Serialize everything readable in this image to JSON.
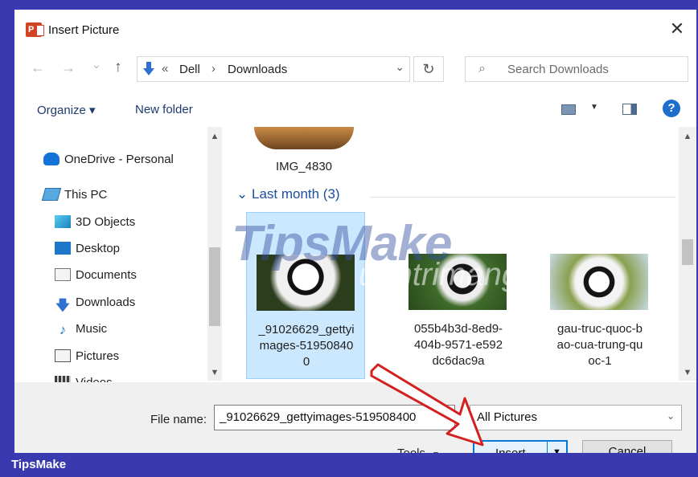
{
  "window": {
    "title": "Insert Picture",
    "close_symbol": "✕"
  },
  "nav": {
    "back": "←",
    "forward": "→",
    "recent": "⌄",
    "up": "↑",
    "breadcrumb_prefix": "«",
    "breadcrumb": [
      "Dell",
      "Downloads"
    ],
    "separator": "›",
    "dropdown": "⌄",
    "refresh": "↻",
    "search_placeholder": "Search Downloads"
  },
  "toolbar": {
    "organize": "Organize ▾",
    "new_folder": "New folder",
    "help": "?",
    "view_dropdown": "▼"
  },
  "sidebar": {
    "items": [
      {
        "label": "OneDrive - Personal",
        "icon": "onedrive-cloud-icon"
      },
      {
        "label": "This PC",
        "icon": "this-pc-icon"
      },
      {
        "label": "3D Objects",
        "icon": "3d-objects-icon"
      },
      {
        "label": "Desktop",
        "icon": "desktop-folder-icon"
      },
      {
        "label": "Documents",
        "icon": "documents-folder-icon"
      },
      {
        "label": "Downloads",
        "icon": "downloads-arrow-icon"
      },
      {
        "label": "Music",
        "icon": "music-note-icon"
      },
      {
        "label": "Pictures",
        "icon": "pictures-folder-icon"
      },
      {
        "label": "Videos",
        "icon": "videos-film-icon"
      }
    ]
  },
  "files": {
    "top_item": "IMG_4830",
    "group_header": "Last month (3)",
    "group_chevron": "⌄",
    "items": [
      {
        "name_lines": [
          "_91026629_gettyi",
          "mages-51950840",
          "0"
        ],
        "selected": true
      },
      {
        "name_lines": [
          "055b4b3d-8ed9-",
          "404b-9571-e592",
          "dc6dac9a"
        ],
        "selected": false
      },
      {
        "name_lines": [
          "gau-truc-quoc-b",
          "ao-cua-trung-qu",
          "oc-1"
        ],
        "selected": false
      }
    ]
  },
  "watermark": {
    "main": "TipsMake",
    "sub": "uantrimang"
  },
  "footer": {
    "file_name_label": "File name:",
    "file_name_value": "_91026629_gettyimages-519508400",
    "filter": "All Pictures",
    "filter_dd": "⌄",
    "tools": "Tools",
    "tools_dd": "▼",
    "insert": "Insert",
    "insert_split": "▼",
    "cancel": "Cancel"
  },
  "brand": "TipsMake",
  "colors": {
    "frame": "#3a3ab0",
    "accent": "#0078d7",
    "selection": "#cce8ff",
    "arrow": "#d42020"
  }
}
